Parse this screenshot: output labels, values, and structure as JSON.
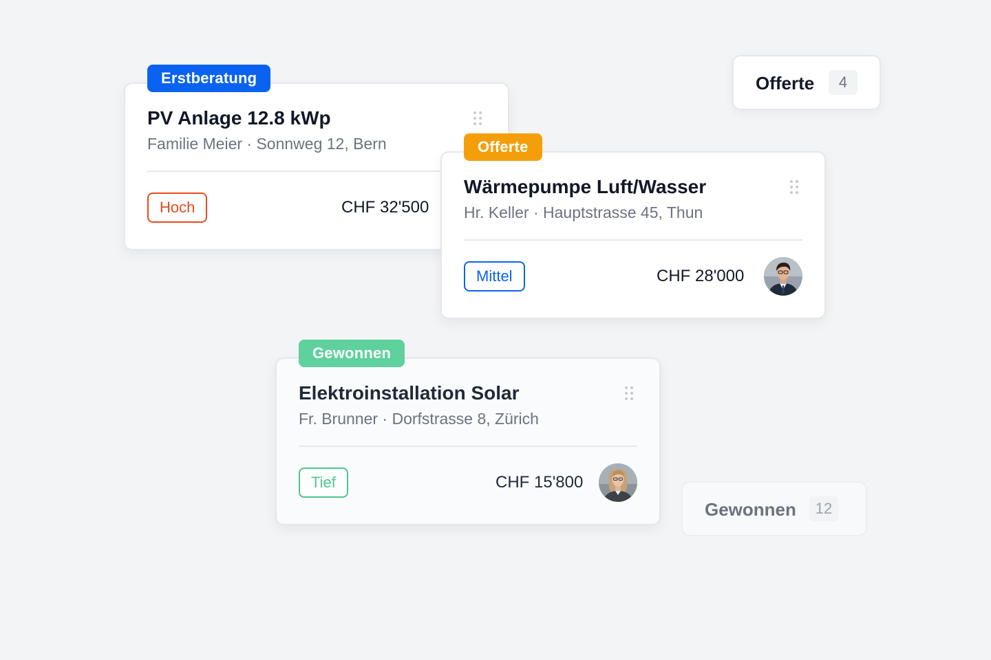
{
  "colors": {
    "background": "#f3f4f6",
    "stage_erstberatung": "#0a63f0",
    "stage_offerte": "#f59e0b",
    "stage_gewonnen": "#5ed19c",
    "priority_hoch": "#ea4a1a",
    "priority_mittel": "#0a63f0",
    "priority_tief": "#4cc68c"
  },
  "column_headers": [
    {
      "title": "Offerte",
      "count": "4"
    },
    {
      "title": "Gewonnen",
      "count": "12"
    }
  ],
  "cards": [
    {
      "stage": "Erstberatung",
      "title": "PV Anlage 12.8 kWp",
      "subtitle": "Familie Meier · Sonnweg 12, Bern",
      "priority": "Hoch",
      "price": "CHF 32'500",
      "drag_icon": "drag-handle-icon"
    },
    {
      "stage": "Offerte",
      "title": "Wärmepumpe Luft/Wasser",
      "subtitle": "Hr. Keller · Hauptstrasse 45, Thun",
      "priority": "Mittel",
      "price": "CHF 28'000",
      "avatar": "man-avatar",
      "drag_icon": "drag-handle-icon"
    },
    {
      "stage": "Gewonnen",
      "title": "Elektroinstallation Solar",
      "subtitle": "Fr. Brunner · Dorfstrasse 8, Zürich",
      "priority": "Tief",
      "price": "CHF 15'800",
      "avatar": "woman-avatar",
      "drag_icon": "drag-handle-icon"
    }
  ]
}
